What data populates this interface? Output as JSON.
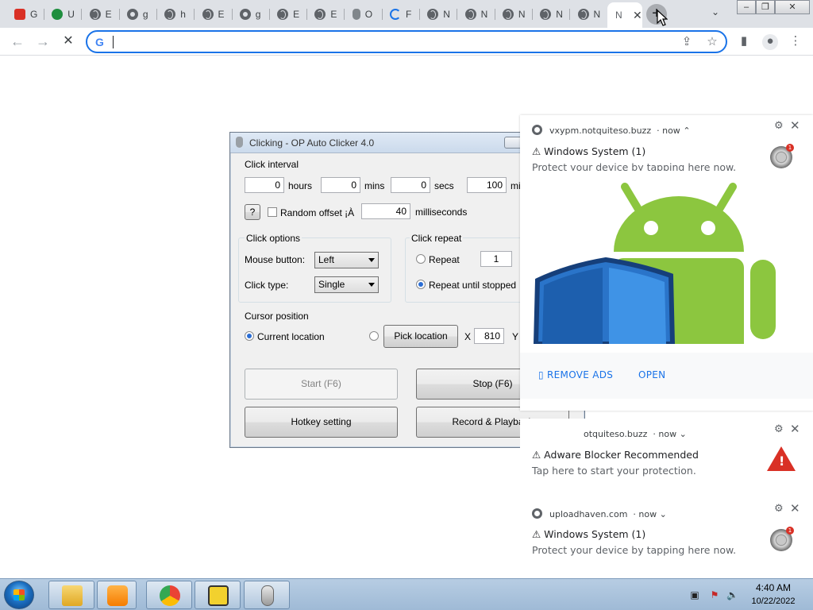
{
  "browser": {
    "tabs": [
      {
        "icon": "red-app-icon",
        "text": "G"
      },
      {
        "icon": "green-app-icon",
        "text": "U"
      },
      {
        "icon": "globe-icon",
        "text": "E"
      },
      {
        "icon": "github-icon",
        "text": "g"
      },
      {
        "icon": "globe-icon",
        "text": "h"
      },
      {
        "icon": "globe-icon",
        "text": "E"
      },
      {
        "icon": "github-icon",
        "text": "g"
      },
      {
        "icon": "globe-icon",
        "text": "E"
      },
      {
        "icon": "globe-icon",
        "text": "E"
      },
      {
        "icon": "mouse-icon",
        "text": "O"
      },
      {
        "icon": "loading-spinner-icon",
        "text": "F"
      },
      {
        "icon": "globe-icon",
        "text": "N"
      },
      {
        "icon": "globe-icon",
        "text": "N"
      },
      {
        "icon": "globe-icon",
        "text": "N"
      },
      {
        "icon": "globe-icon",
        "text": "N"
      },
      {
        "icon": "globe-icon",
        "text": "N"
      }
    ],
    "active_tab": {
      "text": "N",
      "close": "✕"
    },
    "new_tab": "+",
    "tab_search": "⌄",
    "window_controls": {
      "minimize": "–",
      "restore": "❐",
      "close": "✕"
    },
    "nav": {
      "back": "←",
      "forward": "→",
      "stop": "✕"
    },
    "omnibox": {
      "google_icon": "G",
      "value": "",
      "share": "⇪",
      "bookmark": "☆"
    },
    "toolbar_icons": {
      "side_panel": "▮",
      "profile": "●",
      "menu": "⋮"
    }
  },
  "clicker": {
    "title": "Clicking - OP Auto Clicker 4.0",
    "click_interval": {
      "label": "Click interval",
      "hours_value": "0",
      "hours_label": "hours",
      "mins_value": "0",
      "mins_label": "mins",
      "secs_value": "0",
      "secs_label": "secs",
      "ms_value": "100",
      "ms_label": "mi",
      "help": "?",
      "random_offset_label": "Random offset ¡À",
      "random_offset_value": "40",
      "random_offset_unit": "milliseconds"
    },
    "click_options": {
      "label": "Click options",
      "mouse_button_label": "Mouse button:",
      "mouse_button_value": "Left",
      "click_type_label": "Click type:",
      "click_type_value": "Single"
    },
    "click_repeat": {
      "label": "Click repeat",
      "repeat_label": "Repeat",
      "repeat_value": "1",
      "until_stopped_label": "Repeat until stopped"
    },
    "cursor_position": {
      "label": "Cursor position",
      "current_label": "Current location",
      "pick_label": "Pick location",
      "x_label": "X",
      "x_value": "810",
      "y_label": "Y"
    },
    "buttons": {
      "start": "Start (F6)",
      "stop": "Stop (F6)",
      "hotkey": "Hotkey setting",
      "record": "Record & Playback"
    }
  },
  "notifications": [
    {
      "source": "vxypm.notquiteso.buzz",
      "time": "now",
      "chevron": "⌃",
      "title": "⚠ Windows System (1)",
      "body": "Protect your device by tapping here now.",
      "badge_count": "1",
      "actions": {
        "remove_ads": "▯ REMOVE ADS",
        "open": "OPEN"
      }
    },
    {
      "source": "otquiteso.buzz",
      "time": "now",
      "chevron": "⌄",
      "title": "⚠ Adware Blocker Recommended",
      "body": "Tap here to start your protection.",
      "warn_glyph": "!"
    },
    {
      "source": "uploadhaven.com",
      "time": "now",
      "chevron": "⌄",
      "title": "⚠ Windows System (1)",
      "body": "Protect your device by tapping here now.",
      "badge_count": "1"
    }
  ],
  "notification_controls": {
    "gear": "⚙",
    "close": "✕"
  },
  "taskbar": {
    "apps": [
      "file-explorer-icon",
      "media-player-icon",
      "chrome-icon",
      "game-app-icon",
      "auto-clicker-icon"
    ],
    "time": "4:40 AM",
    "date": "10/22/2022",
    "tray": {
      "network": "▣",
      "flag": "⚑",
      "volume": "🔈"
    }
  },
  "colors": {
    "accent": "#1a73e8",
    "taskbar": "#a8c2dd",
    "tab_strip": "#dee1e6",
    "warning": "#d93025",
    "android_green": "#8cc63f"
  }
}
